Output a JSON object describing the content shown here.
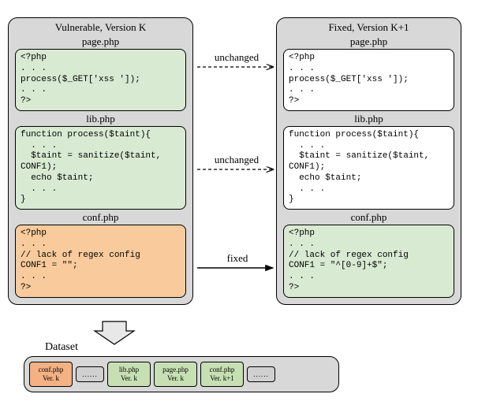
{
  "left": {
    "title": "Vulnerable, Version K",
    "files": {
      "page": {
        "name": "page.php",
        "code": "<?php\n. . .\nprocess($_GET['xss ']);\n. . .\n?>"
      },
      "lib": {
        "name": "lib.php",
        "code": "function process($taint){\n  . . .\n  $taint = sanitize($taint,\nCONF1);\n  echo $taint;\n  . . .\n}"
      },
      "conf": {
        "name": "conf.php",
        "code": "<?php\n. . .\n// lack of regex config\nCONF1 = \"\";\n. . .\n?>"
      }
    }
  },
  "right": {
    "title": "Fixed, Version K+1",
    "files": {
      "page": {
        "name": "page.php",
        "code": "<?php\n. . .\nprocess($_GET['xss ']);\n. . .\n?>"
      },
      "lib": {
        "name": "lib.php",
        "code": "function process($taint){\n  . . .\n  $taint = sanitize($taint,\nCONF1);\n  echo $taint;\n  . . .\n}"
      },
      "conf": {
        "name": "conf.php",
        "code": "<?php\n. . .\n// lack of regex config\nCONF1 = \"^[0-9]+$\";\n. . .\n?>"
      }
    }
  },
  "arrows": {
    "a1": "unchanged",
    "a2": "unchanged",
    "a3": "fixed"
  },
  "dataset": {
    "label": "Dataset",
    "items": [
      {
        "name": "conf.php",
        "ver": "Ver. k",
        "style": "orange-file"
      },
      {
        "name": "......",
        "ver": "",
        "style": "dots"
      },
      {
        "name": "lib.php",
        "ver": "Ver. k",
        "style": "green-file"
      },
      {
        "name": "page.php",
        "ver": "Ver. k",
        "style": "green-file"
      },
      {
        "name": "conf.php",
        "ver": "Ver. k+1",
        "style": "green-file"
      },
      {
        "name": "......",
        "ver": "",
        "style": "dots"
      }
    ]
  }
}
